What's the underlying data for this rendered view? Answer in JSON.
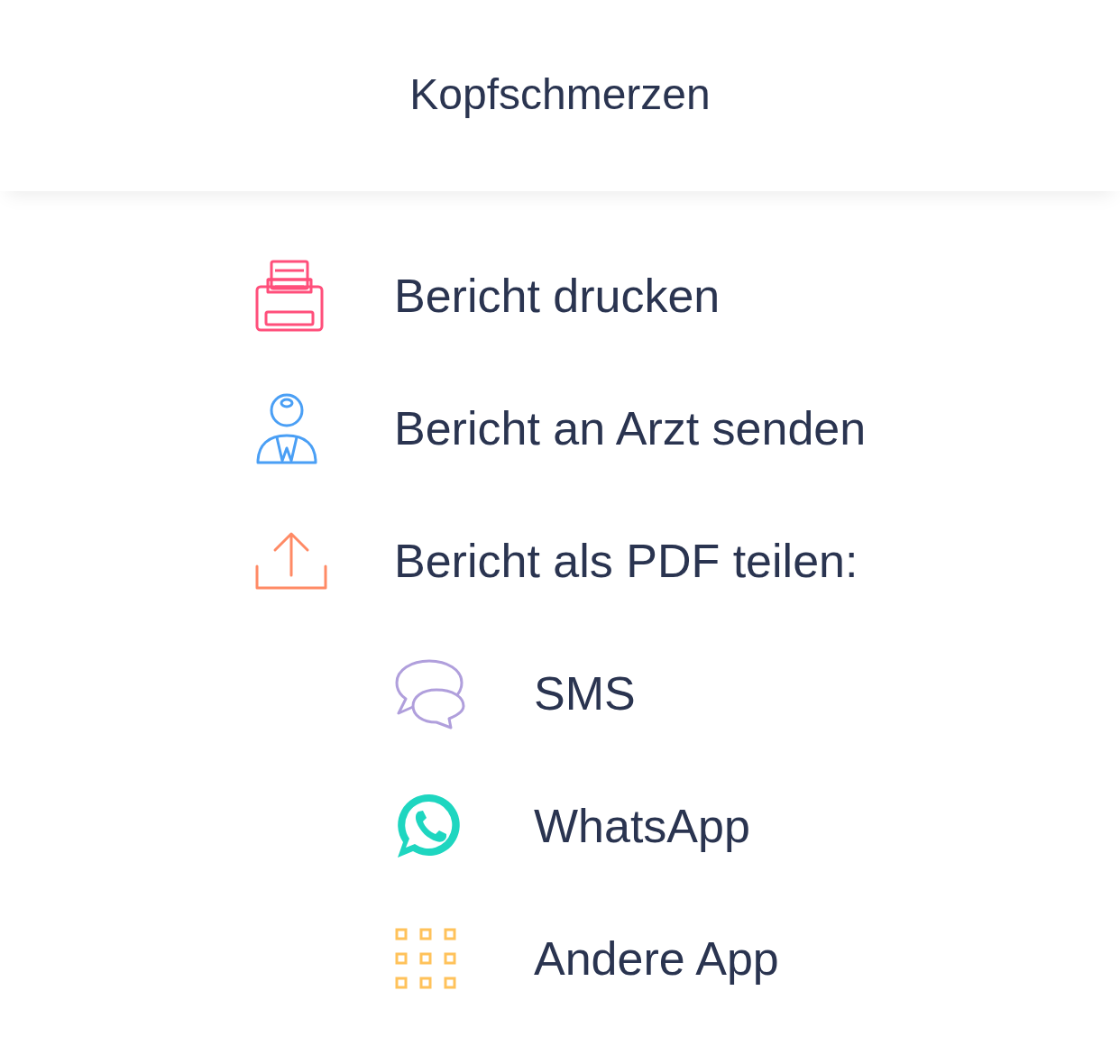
{
  "header": {
    "title": "Kopfschmerzen"
  },
  "actions": [
    {
      "kind": "print",
      "label": "Bericht drucken"
    },
    {
      "kind": "doctor",
      "label": "Bericht an Arzt senden"
    },
    {
      "kind": "share",
      "label": "Bericht als PDF teilen:"
    }
  ],
  "share_options": [
    {
      "kind": "sms",
      "label": "SMS"
    },
    {
      "kind": "whatsapp",
      "label": "WhatsApp"
    },
    {
      "kind": "apps",
      "label": "Andere App"
    }
  ]
}
